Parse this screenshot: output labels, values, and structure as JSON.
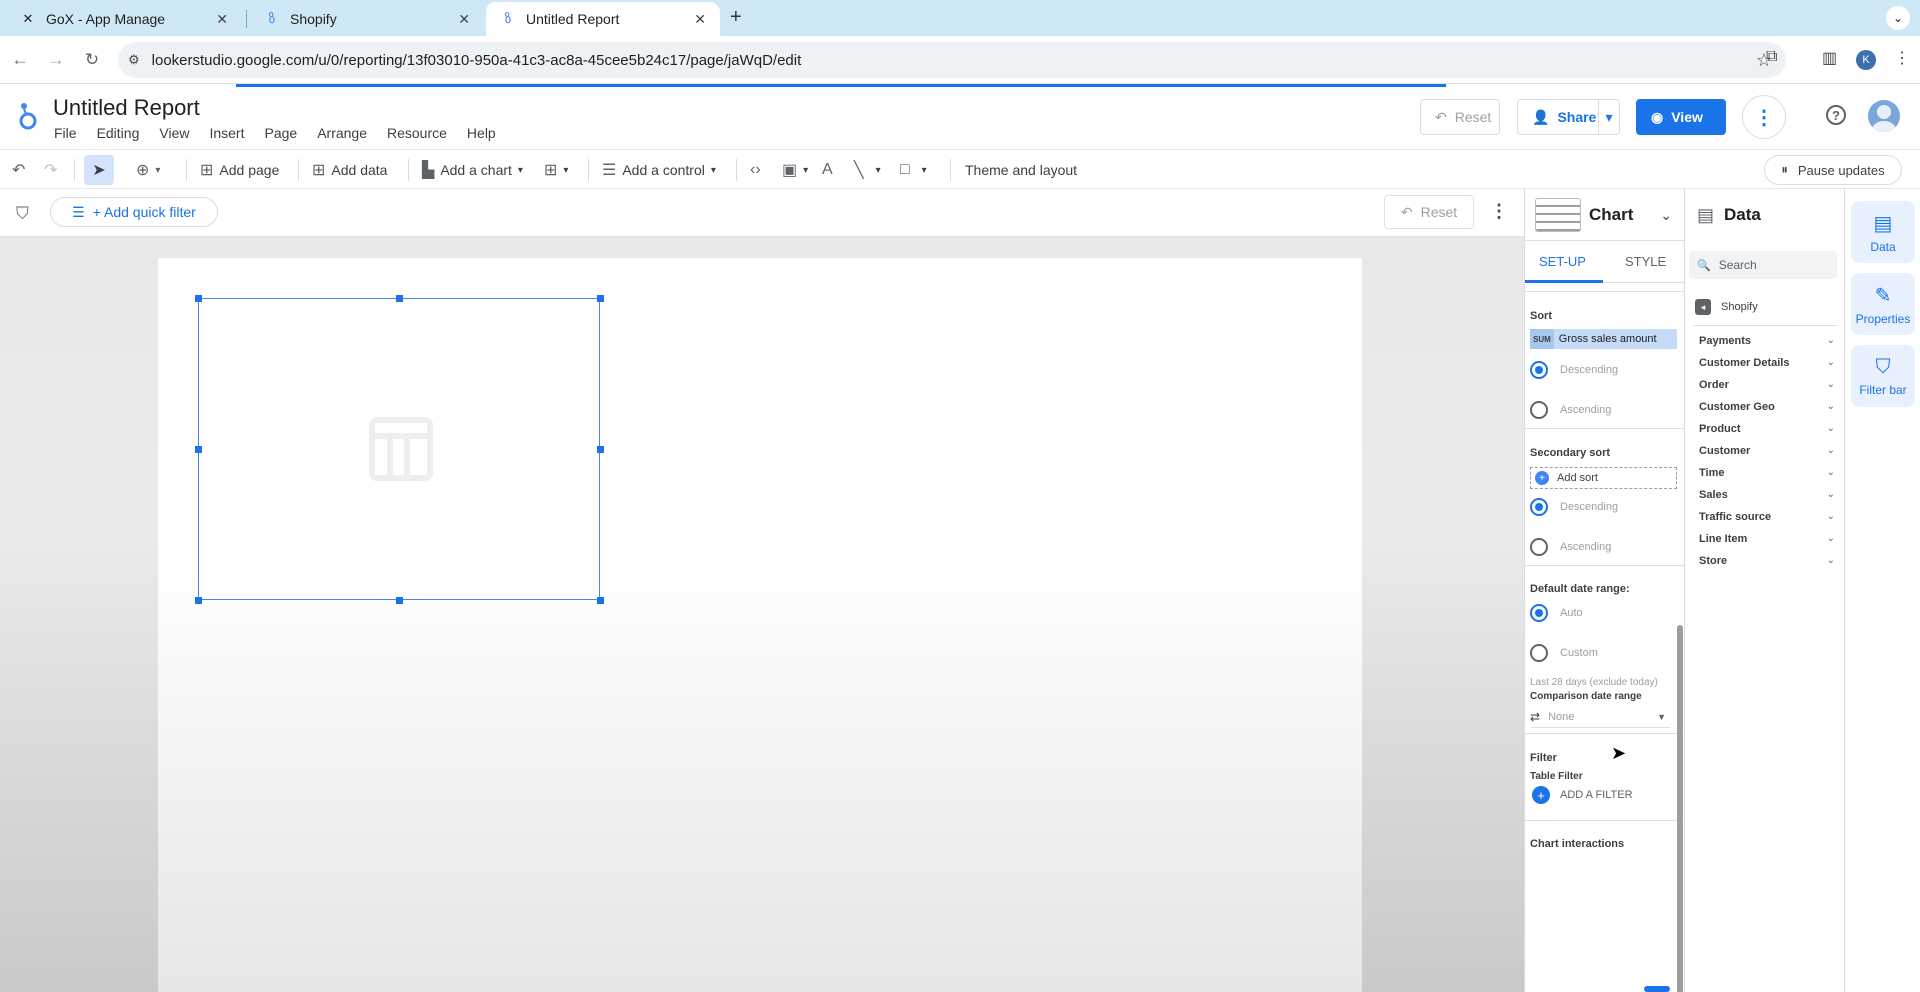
{
  "browser": {
    "tabs": [
      {
        "title": "GoX - App Manage",
        "active": false
      },
      {
        "title": "Shopify",
        "active": false
      },
      {
        "title": "Untitled Report",
        "active": true
      }
    ],
    "url": "lookerstudio.google.com/u/0/reporting/13f03010-950a-41c3-ac8a-45cee5b24c17/page/jaWqD/edit",
    "profile_initial": "K"
  },
  "header": {
    "title": "Untitled Report",
    "menu": [
      "File",
      "Editing",
      "View",
      "Insert",
      "Page",
      "Arrange",
      "Resource",
      "Help"
    ],
    "reset_label": "Reset",
    "share_label": "Share",
    "view_label": "View"
  },
  "toolbar": {
    "add_page": "Add page",
    "add_data": "Add data",
    "add_chart": "Add a chart",
    "add_control": "Add a control",
    "theme": "Theme and layout",
    "pause": "Pause updates"
  },
  "filterbar": {
    "quick_filter": "+ Add quick filter",
    "reset_label": "Reset"
  },
  "chart_panel": {
    "title": "Chart",
    "tabs": [
      "SET-UP",
      "STYLE"
    ],
    "sort_label": "Sort",
    "sort_agg": "SUM",
    "sort_field": "Gross sales amount",
    "descending": "Descending",
    "ascending": "Ascending",
    "secondary_sort_label": "Secondary sort",
    "add_sort": "Add sort",
    "date_range_label": "Default date range:",
    "auto": "Auto",
    "custom": "Custom",
    "date_note": "Last 28 days (exclude today)",
    "comparison_label": "Comparison date range",
    "comparison_value": "None",
    "filter_label": "Filter",
    "table_filter": "Table Filter",
    "add_filter": "ADD A FILTER",
    "interactions_label": "Chart interactions"
  },
  "data_panel": {
    "title": "Data",
    "search_placeholder": "Search",
    "source": "Shopify",
    "groups": [
      "Payments",
      "Customer Details",
      "Order",
      "Customer Geo",
      "Product",
      "Customer",
      "Time",
      "Sales",
      "Traffic source",
      "Line Item",
      "Store"
    ]
  },
  "rail": {
    "data": "Data",
    "properties": "Properties",
    "filter_bar": "Filter bar"
  }
}
